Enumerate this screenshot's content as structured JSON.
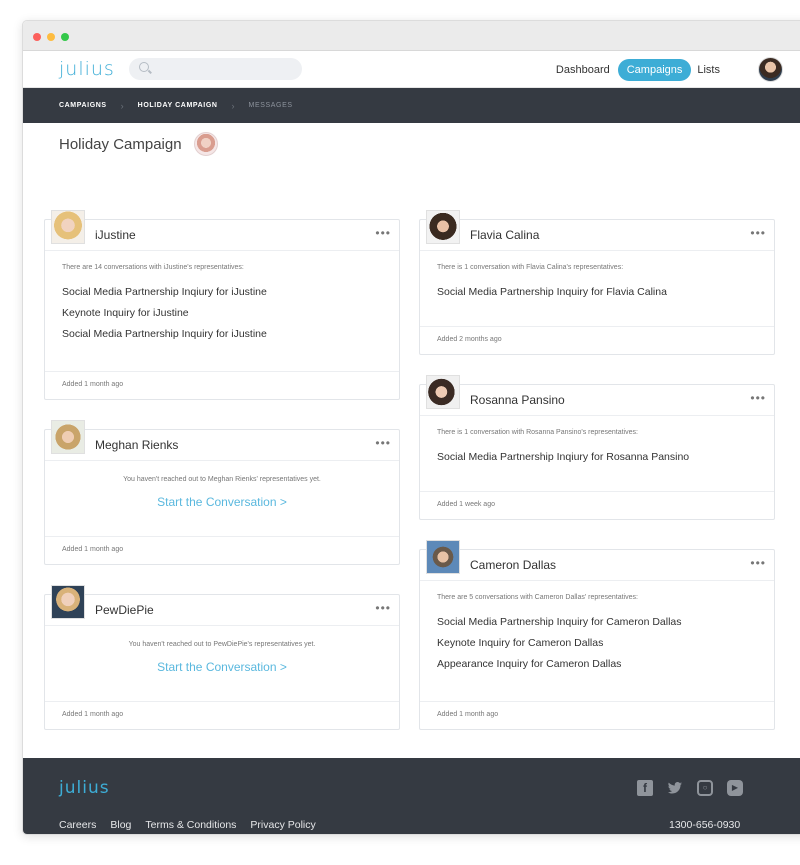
{
  "app": {
    "logo": "julius"
  },
  "search": {
    "placeholder": ""
  },
  "nav": {
    "items": [
      {
        "label": "Dashboard",
        "active": false
      },
      {
        "label": "Campaigns",
        "active": true
      },
      {
        "label": "Lists",
        "active": false
      }
    ]
  },
  "breadcrumb": {
    "items": [
      "CAMPAIGNS",
      "HOLIDAY CAMPAIGN",
      "MESSAGES"
    ]
  },
  "page": {
    "title": "Holiday Campaign"
  },
  "cards": {
    "ijustine": {
      "name": "iJustine",
      "intro": "There are 14 conversations with iJustine's representatives:",
      "items": [
        "Social Media Partnership Inqiury for iJustine",
        "Keynote Inquiry for iJustine",
        "Social Media Partnership Inquiry for iJustine"
      ],
      "added": "Added 1 month ago"
    },
    "meghan": {
      "name": "Meghan Rienks",
      "empty": "You haven't reached out to Meghan Rienks' representatives yet.",
      "cta": "Start the Conversation >",
      "added": "Added 1 month ago"
    },
    "pewdiepie": {
      "name": "PewDiePie",
      "empty": "You haven't reached out to PewDiePie's representatives yet.",
      "cta": "Start the Conversation >",
      "added": "Added 1 month ago"
    },
    "flavia": {
      "name": "Flavia Calina",
      "intro": "There is 1 conversation with Flavia Calina's representatives:",
      "items": [
        "Social Media Partnership Inquiry for Flavia Calina"
      ],
      "added": "Added 2 months ago"
    },
    "rosanna": {
      "name": "Rosanna Pansino",
      "intro": "There is 1 conversation with Rosanna Pansino's representatives:",
      "items": [
        "Social Media Partnership Inqiury for Rosanna Pansino"
      ],
      "added": "Added 1 week ago"
    },
    "cameron": {
      "name": "Cameron Dallas",
      "intro": "There are 5 conversations with Cameron Dallas' representatives:",
      "items": [
        "Social Media Partnership Inquiry for Cameron Dallas",
        "Keynote Inquiry for Cameron Dallas",
        "Appearance Inquiry for Cameron Dallas"
      ],
      "added": "Added 1 month ago"
    }
  },
  "card_menu": "•••",
  "footer": {
    "logo": "julius",
    "links": [
      "Careers",
      "Blog",
      "Terms & Conditions",
      "Privacy Policy"
    ],
    "phone": "1300-656-0930",
    "social_icons": [
      "facebook-icon",
      "twitter-icon",
      "instagram-icon",
      "youtube-icon"
    ]
  },
  "colors": {
    "accent": "#3dadd6",
    "dark": "#353a42",
    "link": "#5ab8de"
  }
}
